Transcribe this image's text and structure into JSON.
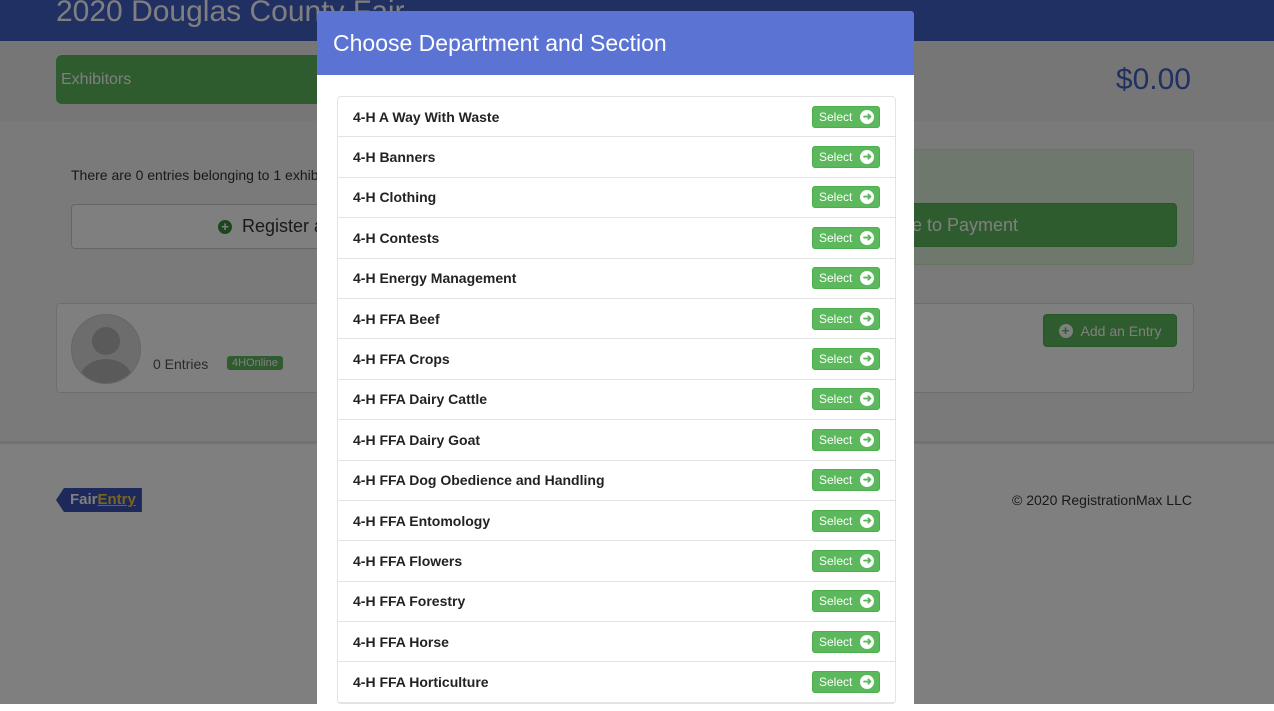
{
  "header": {
    "title": "2020 Douglas County Fair"
  },
  "nav": {
    "exhibitors_tab": "Exhibitors",
    "cart_total": "$0.00"
  },
  "summary": {
    "text": "There are 0 entries belonging to 1 exhibi",
    "register_label": "Register a",
    "payment_label": "e to Payment"
  },
  "exhibitor": {
    "entries": "0 Entries",
    "badge": "4HOnline",
    "add_entry_label": "Add an Entry"
  },
  "footer": {
    "logo_fair": "Fair",
    "logo_entry": "Entry",
    "copyright": "© 2020 RegistrationMax LLC"
  },
  "modal": {
    "title": "Choose Department and Section",
    "select_label": "Select",
    "departments": [
      "4-H A Way With Waste",
      "4-H Banners",
      "4-H Clothing",
      "4-H Contests",
      "4-H Energy Management",
      "4-H FFA Beef",
      "4-H FFA Crops",
      "4-H FFA Dairy Cattle",
      "4-H FFA Dairy Goat",
      "4-H FFA Dog Obedience and Handling",
      "4-H FFA Entomology",
      "4-H FFA Flowers",
      "4-H FFA Forestry",
      "4-H FFA Horse",
      "4-H FFA Horticulture"
    ]
  },
  "colors": {
    "brand_blue": "#4361c4",
    "modal_header": "#5b74d4",
    "success_green": "#5cb85c"
  },
  "icons": {
    "plus": "plus-circle-icon",
    "arrow": "arrow-circle-right-icon"
  }
}
